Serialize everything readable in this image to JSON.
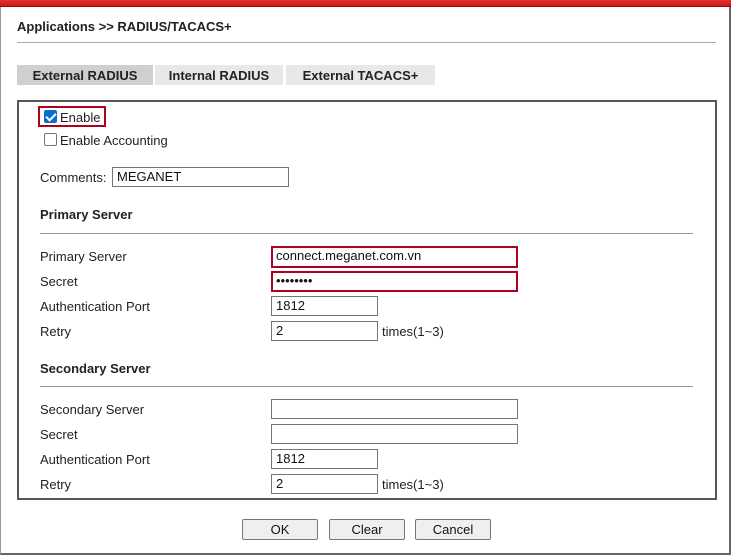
{
  "breadcrumb": "Applications >> RADIUS/TACACS+",
  "tabs": [
    {
      "label": "External RADIUS",
      "active": true
    },
    {
      "label": "Internal RADIUS",
      "active": false
    },
    {
      "label": "External TACACS+",
      "active": false
    }
  ],
  "enable": {
    "label": "Enable",
    "checked": true
  },
  "enable_accounting": {
    "label": "Enable Accounting",
    "checked": false
  },
  "comments": {
    "label": "Comments:",
    "value": "MEGANET"
  },
  "primary": {
    "section_title": "Primary Server",
    "server_label": "Primary Server",
    "server_value": "connect.meganet.com.vn",
    "secret_label": "Secret",
    "secret_value": "••••••••",
    "auth_port_label": "Authentication Port",
    "auth_port_value": "1812",
    "retry_label": "Retry",
    "retry_value": "2",
    "retry_suffix": "times(1~3)"
  },
  "secondary": {
    "section_title": "Secondary Server",
    "server_label": "Secondary Server",
    "server_value": "",
    "secret_label": "Secret",
    "secret_value": "",
    "auth_port_label": "Authentication Port",
    "auth_port_value": "1812",
    "retry_label": "Retry",
    "retry_value": "2",
    "retry_suffix": "times(1~3)"
  },
  "buttons": {
    "ok": "OK",
    "clear": "Clear",
    "cancel": "Cancel"
  },
  "colors": {
    "accent_red": "#c81818",
    "highlight": "#b00020",
    "checkbox": "#0a6ed1"
  }
}
